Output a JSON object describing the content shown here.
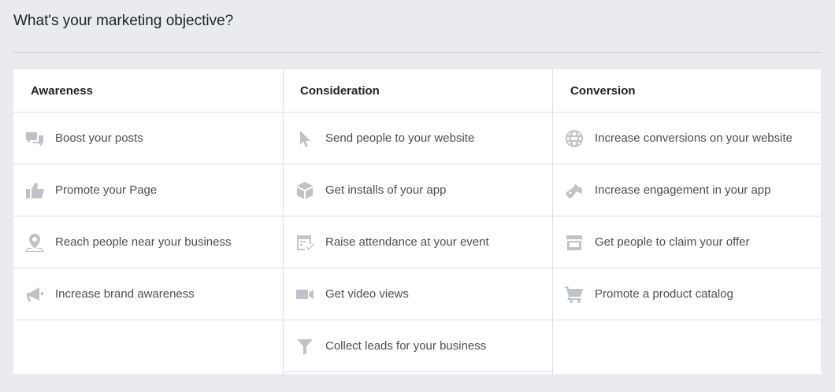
{
  "page": {
    "title": "What's your marketing objective?"
  },
  "colors": {
    "background": "#e9ebee",
    "panel": "#ffffff",
    "icon": "#bec3c9",
    "text": "#4b4f56",
    "heading": "#1d2129"
  },
  "columns": [
    {
      "header": "Awareness",
      "items": [
        {
          "label": "Boost your posts",
          "icon": "chat-bubbles-icon"
        },
        {
          "label": "Promote your Page",
          "icon": "thumbs-up-icon"
        },
        {
          "label": "Reach people near your business",
          "icon": "map-pin-icon"
        },
        {
          "label": "Increase brand awareness",
          "icon": "megaphone-icon"
        }
      ]
    },
    {
      "header": "Consideration",
      "items": [
        {
          "label": "Send people to your website",
          "icon": "cursor-icon"
        },
        {
          "label": "Get installs of your app",
          "icon": "box-icon"
        },
        {
          "label": "Raise attendance at your event",
          "icon": "calendar-icon"
        },
        {
          "label": "Get video views",
          "icon": "video-camera-icon"
        },
        {
          "label": "Collect leads for your business",
          "icon": "funnel-icon"
        }
      ]
    },
    {
      "header": "Conversion",
      "items": [
        {
          "label": "Increase conversions on your website",
          "icon": "globe-icon"
        },
        {
          "label": "Increase engagement in your app",
          "icon": "gamepad-icon"
        },
        {
          "label": "Get people to claim your offer",
          "icon": "storefront-icon"
        },
        {
          "label": "Promote a product catalog",
          "icon": "shopping-cart-icon"
        }
      ]
    }
  ]
}
